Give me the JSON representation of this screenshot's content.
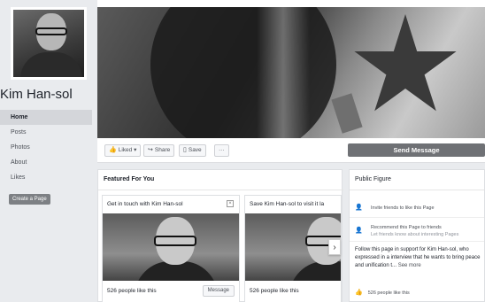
{
  "sidebar": {
    "page_name": "Kim Han-sol",
    "nav": [
      "Home",
      "Posts",
      "Photos",
      "About",
      "Likes"
    ],
    "create_page": "Create a Page"
  },
  "actions": {
    "liked": "Liked",
    "share": "Share",
    "save": "Save",
    "more": "···",
    "send_message": "Send Message"
  },
  "featured": {
    "title": "Featured For You",
    "cards": [
      {
        "title": "Get in touch with Kim Han-sol",
        "likes": "526 people like this",
        "button": "Message"
      },
      {
        "title": "Save Kim Han-sol to visit it la",
        "likes": "526 people like this"
      }
    ]
  },
  "public_figure": {
    "title": "Public Figure",
    "invite": "Invite friends to like this Page",
    "recommend": "Recommend this Page to friends",
    "recommend_sub": "Let friends know about interesting Pages",
    "description": "Follow this page in support for Kim Han-sol, who expressed in a interview that he wants to bring peace and unification t...",
    "see_more": "See more",
    "likes": "526 people like this"
  },
  "icons": {
    "like": "thumbs-up-icon",
    "share": "share-icon",
    "save": "bookmark-icon",
    "invite": "add-person-icon",
    "recommend": "add-person-icon"
  }
}
